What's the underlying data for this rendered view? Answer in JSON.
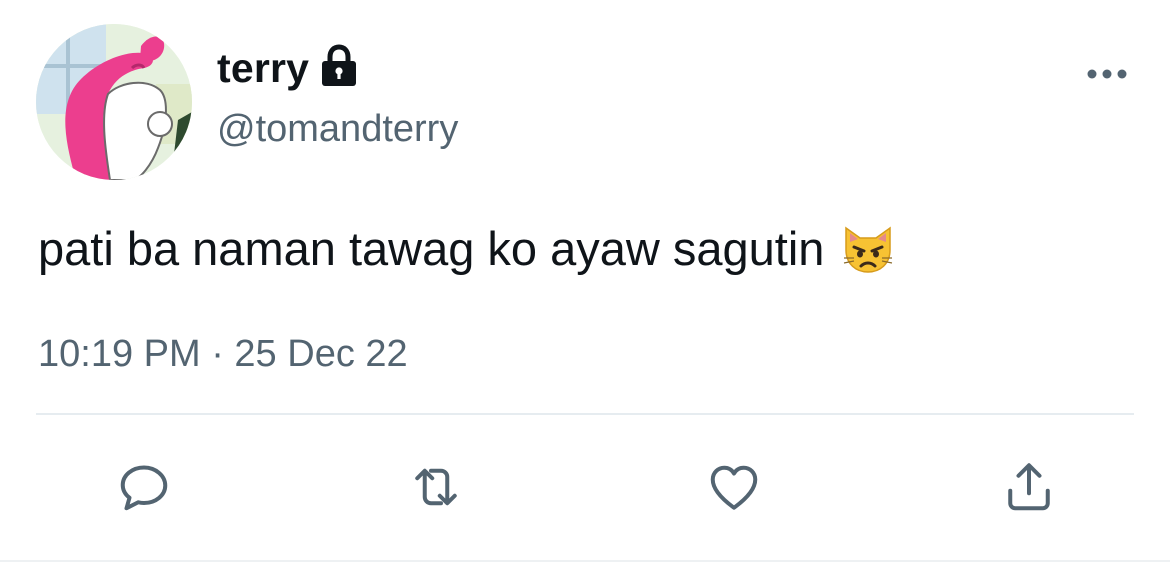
{
  "user": {
    "display_name": "terry",
    "handle": "@tomandterry",
    "protected_icon": "lock-icon",
    "avatar": "cartoon-avatar"
  },
  "tweet": {
    "text": "pati ba naman tawag ko ayaw sagutin",
    "emoji": "pouting-cat-emoji",
    "timestamp": "10:19 PM · 25 Dec 22"
  },
  "menu": {
    "icon": "more-dots-icon"
  },
  "actions": [
    {
      "name": "reply",
      "icon": "reply-icon"
    },
    {
      "name": "retweet",
      "icon": "retweet-icon"
    },
    {
      "name": "like",
      "icon": "heart-icon"
    },
    {
      "name": "share",
      "icon": "share-icon"
    }
  ],
  "colors": {
    "text_primary": "#0f1419",
    "text_secondary": "#536471",
    "divider": "#e6ecf0"
  }
}
